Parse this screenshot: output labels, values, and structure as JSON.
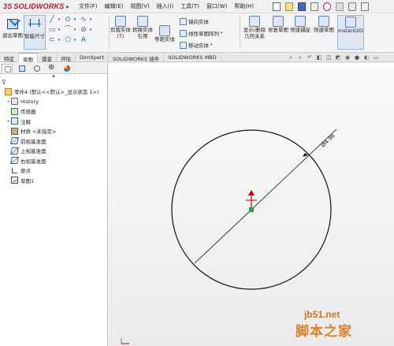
{
  "app": {
    "logo_text": "SOLIDWORKS",
    "logo_prefix": "3S",
    "expand_arrow": "▸"
  },
  "menu": [
    {
      "label": "文件(F)"
    },
    {
      "label": "编辑(E)"
    },
    {
      "label": "视图(V)"
    },
    {
      "label": "插入(I)"
    },
    {
      "label": "工具(T)"
    },
    {
      "label": "窗口(W)"
    },
    {
      "label": "帮助(H)"
    }
  ],
  "quick_access_icons": [
    "new-icon",
    "open-icon",
    "save-icon",
    "print-icon",
    "undo-icon",
    "select-icon",
    "rebuild-icon",
    "options-icon"
  ],
  "commands": {
    "exit_sketch": "退出草图",
    "smart_dimension": "智能尺寸",
    "trim": "剪裁实体(T)",
    "convert": "转换实体引用",
    "offset": "等距实体",
    "mirror": "镜向实体",
    "linear_pattern": "线性草图阵列",
    "move": "移动实体",
    "display_relations": "显示/删除几何关系",
    "repair_sketch": "修复草图",
    "quick_snaps": "快速捕捉",
    "rapid_sketch": "快速草图",
    "instant2d": "Instant2D"
  },
  "tabs": [
    {
      "label": "特征",
      "active": false
    },
    {
      "label": "草图",
      "active": true
    },
    {
      "label": "钣金",
      "active": false
    },
    {
      "label": "评估",
      "active": false
    },
    {
      "label": "DimXpert",
      "active": false
    },
    {
      "label": "SOLIDWORKS 插件",
      "active": false
    },
    {
      "label": "SOLIDWORKS MBD",
      "active": false
    }
  ],
  "feature_tree": {
    "root": "零件4 (默认<<默认>_显示状态 1>)",
    "items": [
      {
        "label": "History",
        "icon": "history-icon"
      },
      {
        "label": "传感器",
        "icon": "sensor-icon"
      },
      {
        "label": "注解",
        "icon": "annotation-icon"
      },
      {
        "label": "材质 <未指定>",
        "icon": "material-icon"
      },
      {
        "label": "前视基准面",
        "icon": "plane-icon"
      },
      {
        "label": "上视基准面",
        "icon": "plane-icon"
      },
      {
        "label": "右视基准面",
        "icon": "plane-icon"
      },
      {
        "label": "原点",
        "icon": "origin-icon"
      },
      {
        "label": "草图1",
        "icon": "sketch-icon"
      }
    ]
  },
  "sketch": {
    "dimension_text": "Ø4.96",
    "circle_color": "#111111",
    "dimension_color": "#111111",
    "origin_color": "#cc0000",
    "point_color": "#1aa34a"
  },
  "watermark": {
    "site": "jb51.net",
    "name": "脚本之家"
  }
}
